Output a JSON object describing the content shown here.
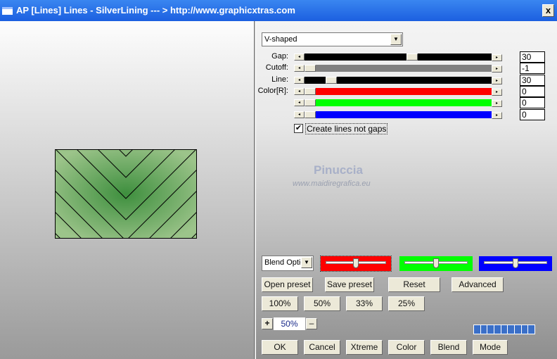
{
  "window": {
    "title": "AP [Lines]  Lines - SilverLining    --- > http://www.graphicxtras.com",
    "close_label": "x"
  },
  "shape_select": {
    "value": "V-shaped"
  },
  "sliders": [
    {
      "label": "Gap:",
      "value": "30",
      "track_color": "#000000",
      "fraction": 0.58
    },
    {
      "label": "Cutoff:",
      "value": "-1",
      "track_color": "#808080",
      "fraction": 0.0
    },
    {
      "label": "Line:",
      "value": "30",
      "track_color": "#000000",
      "fraction": 0.12
    },
    {
      "label": "Color[R]:",
      "value": "0",
      "track_color": "#ff0000",
      "fraction": 0.0
    },
    {
      "label": "",
      "value": "0",
      "track_color": "#00ff00",
      "fraction": 0.0
    },
    {
      "label": "",
      "value": "0",
      "track_color": "#0000ff",
      "fraction": 0.0
    }
  ],
  "checkbox": {
    "label": "Create lines not gaps",
    "checked": true
  },
  "watermark": {
    "name": "Pinuccia",
    "url": "www.maidiregrafica.eu"
  },
  "blend_select": {
    "value": "Blend Optio"
  },
  "color_sliders": [
    {
      "color": "#ff0000",
      "fraction": 0.5
    },
    {
      "color": "#00ff00",
      "fraction": 0.5
    },
    {
      "color": "#0000ff",
      "fraction": 0.5
    }
  ],
  "buttons_row1": [
    "Open preset",
    "Save preset",
    "Reset",
    "Advanced"
  ],
  "zoom_buttons": [
    "100%",
    "50%",
    "33%",
    "25%"
  ],
  "zoom": {
    "plus": "+",
    "value": "50%",
    "minus": "–"
  },
  "progress": {
    "segments": 9,
    "filled": 9,
    "color": "#3a6fc8"
  },
  "buttons_bottom": [
    "OK",
    "Cancel",
    "Xtreme",
    "Color",
    "Blend",
    "Mode"
  ]
}
